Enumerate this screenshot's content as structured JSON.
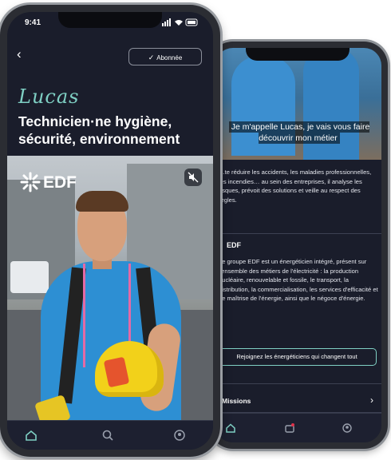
{
  "colors": {
    "accent": "#7fd0c4",
    "background": "#1a1d2b",
    "text": "#ffffff"
  },
  "status_bar": {
    "time": "9:41"
  },
  "header": {
    "back_icon": "back-arrow-icon",
    "follow_label": "Abonnée"
  },
  "profile": {
    "name": "Lucas",
    "job_title": "Technicien·ne hygiène, sécurité, environnement"
  },
  "media": {
    "brand_logo": "EDF",
    "mute_icon": "muted-speaker-icon"
  },
  "detail_screen": {
    "video_subtitle": "Je m'appelle Lucas, je vais vous faire découvrir mon métier",
    "description": "…te réduire les accidents, les maladies professionnelles, les incendies… au sein des entreprises, il analyse les risques, prévoit des solutions et veille au respect des règles.",
    "company_title": "EDF",
    "company_text": "Le groupe EDF est un énergéticien intégré, présent sur l'ensemble des métiers de l'électricité : la production nucléaire, renouvelable et fossile, le transport, la distribution, la commercialisation, les services d'efficacité et de maîtrise de l'énergie, ainsi que le négoce d'énergie.",
    "join_button": "Rejoignez les énergéticiens qui changent tout",
    "missions_label": "Missions"
  },
  "tabbar": {
    "tabs": [
      "home-icon",
      "search-icon",
      "profile-icon"
    ],
    "back_tabs": [
      "home-icon",
      "briefcase-icon",
      "profile-icon"
    ]
  }
}
